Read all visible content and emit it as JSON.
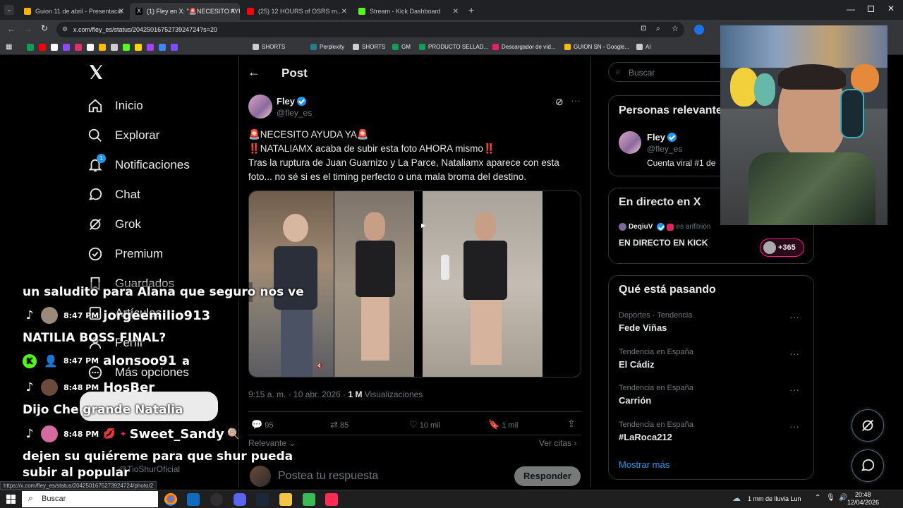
{
  "browser": {
    "tabs": [
      {
        "title": "Guion 11 de abril - Presentació",
        "color": "#f4b400"
      },
      {
        "title": "(1) Fley en X: \"🚨NECESITO AYU",
        "color": "#000000"
      },
      {
        "title": "(25) 12 HOURS of OSRS m...",
        "color": "#ff0000"
      },
      {
        "title": "Stream - Kick Dashboard",
        "color": "#53fc18"
      }
    ],
    "url": "x.com/fley_es/status/2042501675273924724?s=20",
    "bookmarks": [
      "SHORTS",
      "Perplexity",
      "SHORTS",
      "GM",
      "PRODUCTO SELLAD...",
      "Descargador de víd...",
      "GUION SN - Google...",
      "AI"
    ],
    "status_url": "https://x.com/fley_es/status/2042501675273924724/photo/2"
  },
  "nav": {
    "items": [
      {
        "label": "Inicio",
        "icon": "home-icon"
      },
      {
        "label": "Explorar",
        "icon": "search-icon"
      },
      {
        "label": "Notificaciones",
        "icon": "bell-icon",
        "badge": "1"
      },
      {
        "label": "Chat",
        "icon": "chat-icon"
      },
      {
        "label": "Grok",
        "icon": "grok-icon"
      },
      {
        "label": "Premium",
        "icon": "premium-icon"
      },
      {
        "label": "Guardados",
        "icon": "bookmark-icon"
      },
      {
        "label": "Artículos",
        "icon": "article-icon"
      },
      {
        "label": "Perfil",
        "icon": "profile-icon"
      },
      {
        "label": "Más opciones",
        "icon": "more-icon"
      }
    ],
    "profile_handle": "@TioShurOficial"
  },
  "post": {
    "header_title": "Post",
    "author_name": "Fley",
    "author_handle": "@fley_es",
    "line1": "🚨NECESITO AYUDA YA🚨",
    "line2": "‼️NATALIAMX acaba de subir esta foto AHORA mismo‼️",
    "line3": "Tras la ruptura de Juan Guarnizo y La Parce, Nataliamx aparece con esta foto... no sé si es el timing perfecto o una mala broma del destino.",
    "timestamp": "9:15 a. m. · 10 abr. 2026 ·",
    "views_count": "1 M",
    "views_label": "Visualizaciones",
    "replies": "95",
    "reposts": "85",
    "likes": "10 mil",
    "bookmarks": "1 mil",
    "sort_label": "Relevante",
    "quotes_label": "Ver citas",
    "reply_placeholder": "Postea tu respuesta",
    "reply_button": "Responder"
  },
  "sidebar": {
    "search_placeholder": "Buscar",
    "relevant_title": "Personas relevantes",
    "relevant_name": "Fley",
    "relevant_handle": "@fley_es",
    "relevant_bio": "Cuenta viral #1 de",
    "live_title": "En directo en X",
    "live_host": "DeqiuV",
    "live_host_suffix": "es anfitrión",
    "live_event": "EN DIRECTO EN KICK",
    "live_count": "+365",
    "trends_title": "Qué está pasando",
    "trends": [
      {
        "category": "Deportes · Tendencia",
        "name": "Fede Viñas"
      },
      {
        "category": "Tendencia en España",
        "name": "El Cádiz"
      },
      {
        "category": "Tendencia en España",
        "name": "Carrión"
      },
      {
        "category": "Tendencia en España",
        "name": "#LaRoca212"
      }
    ],
    "show_more": "Mostrar más"
  },
  "stream_chat": {
    "msg1": "un saludito para Alana que seguro nos ve",
    "u1_time": "8:47 PM",
    "u1_name": "jorgeemilio913",
    "msg2": "NATILIA BOSS FINAL?",
    "u2_time": "8:47 PM",
    "u2_name": "alonsoo91",
    "u2_extra": "a",
    "u3_time": "8:48 PM",
    "u3_name": "HosBer",
    "msg3": "Dijo Che grande Natalia",
    "u4_time": "8:48 PM",
    "u4_name": "Sweet_Sandy",
    "msg4a": "dejen su quiéreme para que shur pueda",
    "msg4b": "subir al popular"
  },
  "taskbar": {
    "search_label": "Buscar",
    "weather": "1 mm de lluvia Lun",
    "time": "20:48",
    "date": "12/04/2026"
  }
}
